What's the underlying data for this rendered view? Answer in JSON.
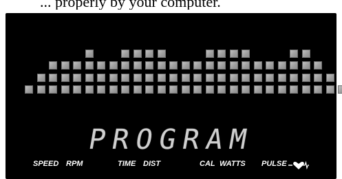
{
  "caption": "... properly by your computer.",
  "display": {
    "matrix_columns": [
      1,
      2,
      3,
      3,
      3,
      4,
      3,
      3,
      4,
      4,
      4,
      4,
      3,
      3,
      3,
      4,
      4,
      4,
      4,
      3,
      3,
      3,
      4,
      4,
      3,
      2,
      1
    ],
    "main_text": "PROGRAM",
    "indicators": {
      "speed": "SPEED",
      "rpm": "RPM",
      "time": "TIME",
      "dist": "DIST",
      "cal": "CAL",
      "watts": "WATTS",
      "pulse": "PULSE"
    },
    "pulse_icon": "heart-pulse-icon",
    "colors": {
      "background": "#000000",
      "segment_on": "#b0b0b0",
      "indicator_text": "#ffffff"
    }
  }
}
